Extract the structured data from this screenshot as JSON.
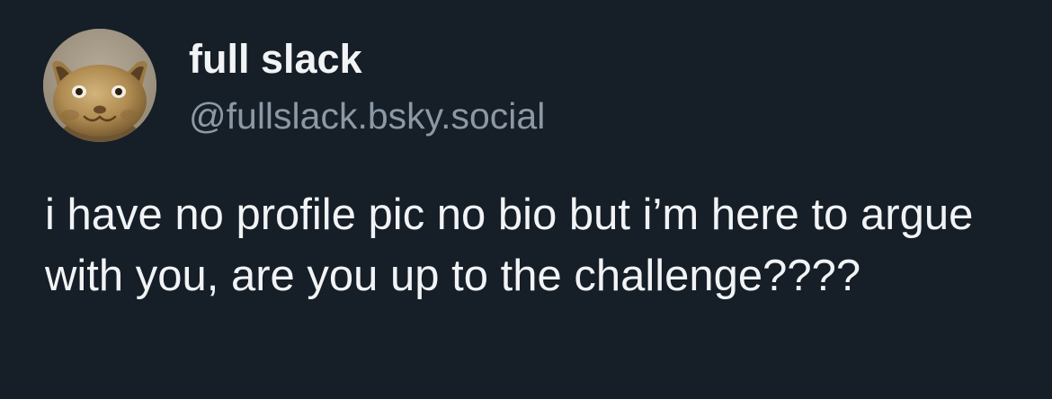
{
  "post": {
    "author": {
      "display_name": "full slack",
      "handle": "@fullslack.bsky.social",
      "avatar_icon": "cat-figurine-avatar"
    },
    "text": "i have no profile pic no bio but i’m here to argue with you, are you up to the challenge????"
  },
  "colors": {
    "background": "#161e27",
    "primary_text": "#f1f3f5",
    "secondary_text": "#8b98a5"
  }
}
